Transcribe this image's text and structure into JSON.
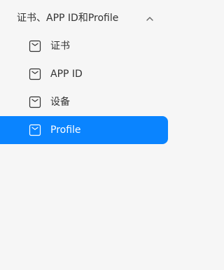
{
  "sidebar": {
    "section": {
      "title": "证书、APP ID和Profile",
      "expanded": true,
      "chevron_icon": "chevron-up-icon"
    },
    "items": [
      {
        "label": "证书",
        "icon": "box-icon",
        "active": false
      },
      {
        "label": "APP ID",
        "icon": "box-icon",
        "active": false
      },
      {
        "label": "设备",
        "icon": "box-icon",
        "active": false
      },
      {
        "label": "Profile",
        "icon": "box-icon",
        "active": true
      }
    ],
    "colors": {
      "background": "#f6f6f6",
      "active_background": "#0a84ff",
      "text": "#333333",
      "active_text": "#ffffff"
    }
  }
}
